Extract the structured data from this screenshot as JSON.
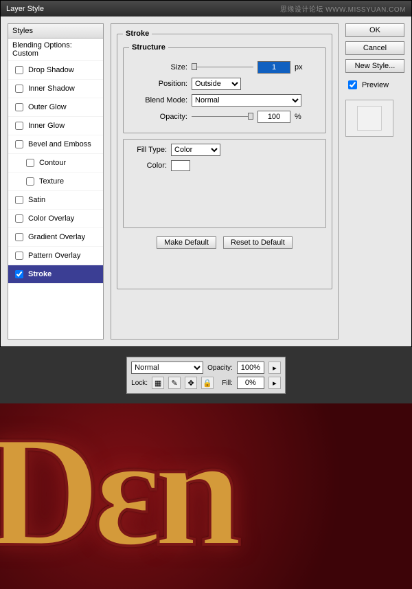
{
  "titlebar": {
    "title": "Layer Style",
    "watermark": "思缘设计论坛 WWW.MISSYUAN.COM"
  },
  "stylesPanel": {
    "header": "Styles",
    "blending": "Blending Options: Custom",
    "items": [
      {
        "label": "Drop Shadow",
        "checked": false
      },
      {
        "label": "Inner Shadow",
        "checked": false
      },
      {
        "label": "Outer Glow",
        "checked": false
      },
      {
        "label": "Inner Glow",
        "checked": false
      },
      {
        "label": "Bevel and Emboss",
        "checked": false
      },
      {
        "label": "Contour",
        "checked": false,
        "indent": true
      },
      {
        "label": "Texture",
        "checked": false,
        "indent": true
      },
      {
        "label": "Satin",
        "checked": false
      },
      {
        "label": "Color Overlay",
        "checked": false
      },
      {
        "label": "Gradient Overlay",
        "checked": false
      },
      {
        "label": "Pattern Overlay",
        "checked": false
      },
      {
        "label": "Stroke",
        "checked": true,
        "active": true
      }
    ]
  },
  "stroke": {
    "title": "Stroke",
    "structure_title": "Structure",
    "size_label": "Size:",
    "size_value": "1",
    "size_unit": "px",
    "position_label": "Position:",
    "position_value": "Outside",
    "blend_label": "Blend Mode:",
    "blend_value": "Normal",
    "opacity_label": "Opacity:",
    "opacity_value": "100",
    "opacity_unit": "%",
    "filltype_label": "Fill Type:",
    "filltype_value": "Color",
    "color_label": "Color:",
    "color_hex": "#ffffff",
    "make_default": "Make Default",
    "reset_default": "Reset to Default"
  },
  "buttons": {
    "ok": "OK",
    "cancel": "Cancel",
    "newstyle": "New Style...",
    "preview": "Preview"
  },
  "layerbar": {
    "blend": "Normal",
    "opacity_label": "Opacity:",
    "opacity": "100%",
    "lock_label": "Lock:",
    "fill_label": "Fill:",
    "fill": "0%"
  },
  "preview_text": "Dεn"
}
